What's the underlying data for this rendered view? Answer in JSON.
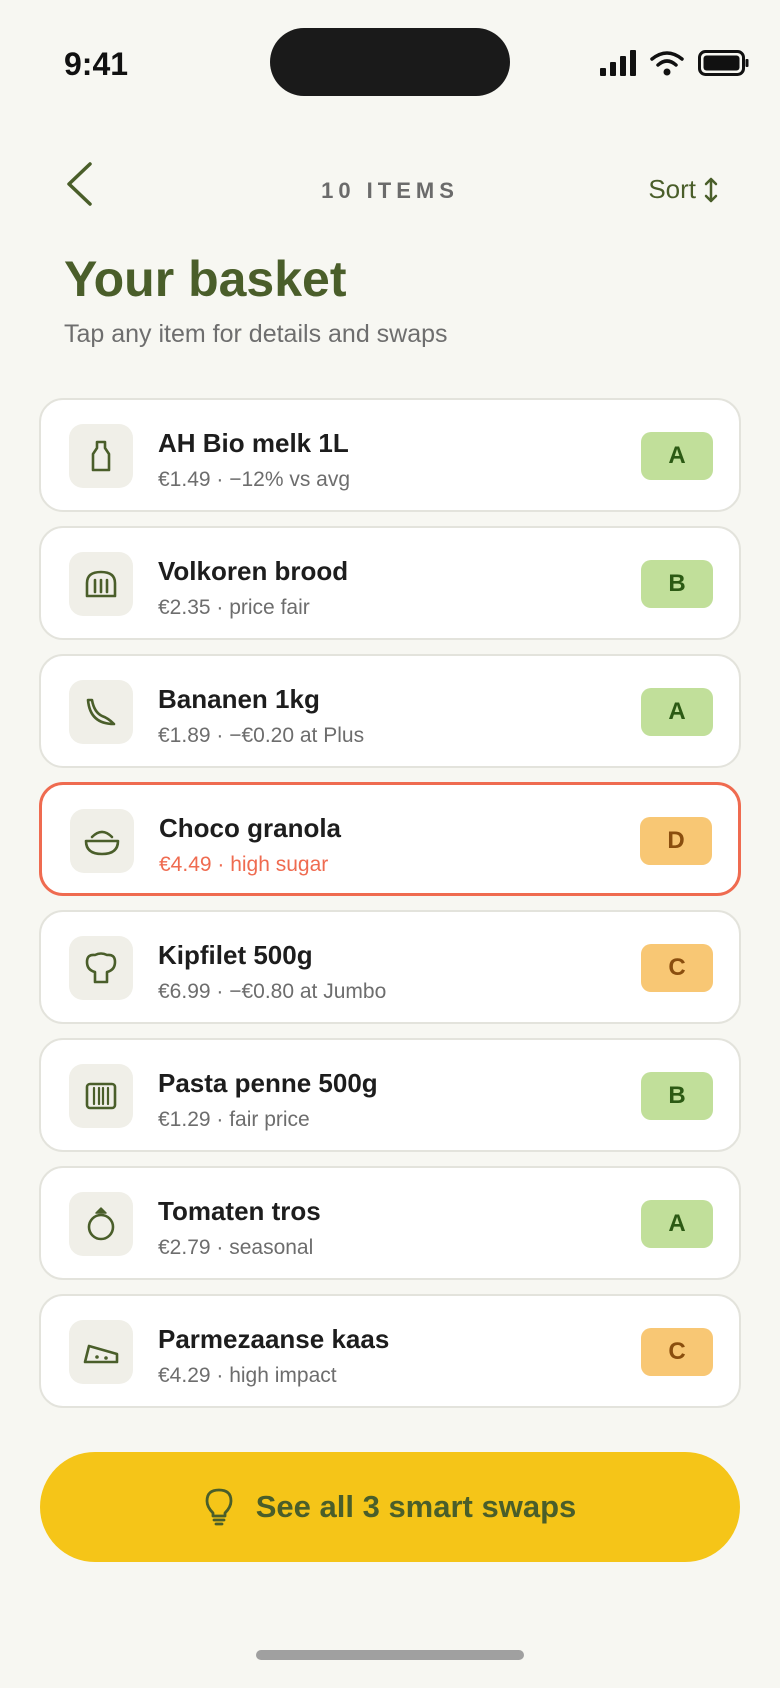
{
  "status_bar": {
    "time": "9:41"
  },
  "header": {
    "items_count": "10 ITEMS",
    "sort_label": "Sort"
  },
  "page": {
    "title": "Your basket",
    "subtitle": "Tap any item for details and swaps"
  },
  "items": [
    {
      "name": "AH Bio melk 1L",
      "detail": "€1.49 · −12% vs avg",
      "grade": "A",
      "icon": "milk-bottle-icon"
    },
    {
      "name": "Volkoren brood",
      "detail": "€2.35 · price fair",
      "grade": "B",
      "icon": "bread-icon"
    },
    {
      "name": "Bananen 1kg",
      "detail": "€1.89 · −€0.20 at Plus",
      "grade": "A",
      "icon": "banana-icon"
    },
    {
      "name": "Choco granola",
      "detail": "€4.49 · high sugar",
      "grade": "D",
      "icon": "bowl-icon",
      "flagged": true
    },
    {
      "name": "Kipfilet 500g",
      "detail": "€6.99 · −€0.80 at Jumbo",
      "grade": "C",
      "icon": "chicken-icon"
    },
    {
      "name": "Pasta penne 500g",
      "detail": "€1.29 · fair price",
      "grade": "B",
      "icon": "pasta-icon"
    },
    {
      "name": "Tomaten tros",
      "detail": "€2.79 · seasonal",
      "grade": "A",
      "icon": "tomato-icon"
    },
    {
      "name": "Parmezaanse kaas",
      "detail": "€4.29 · high impact",
      "grade": "C",
      "icon": "cheese-icon"
    }
  ],
  "cta": {
    "label": "See all 3 smart swaps",
    "icon": "lightbulb-icon"
  },
  "colors": {
    "accent_green": "#4a5e2a",
    "flag_red": "#ef6b50",
    "cta_yellow": "#f5c518"
  }
}
